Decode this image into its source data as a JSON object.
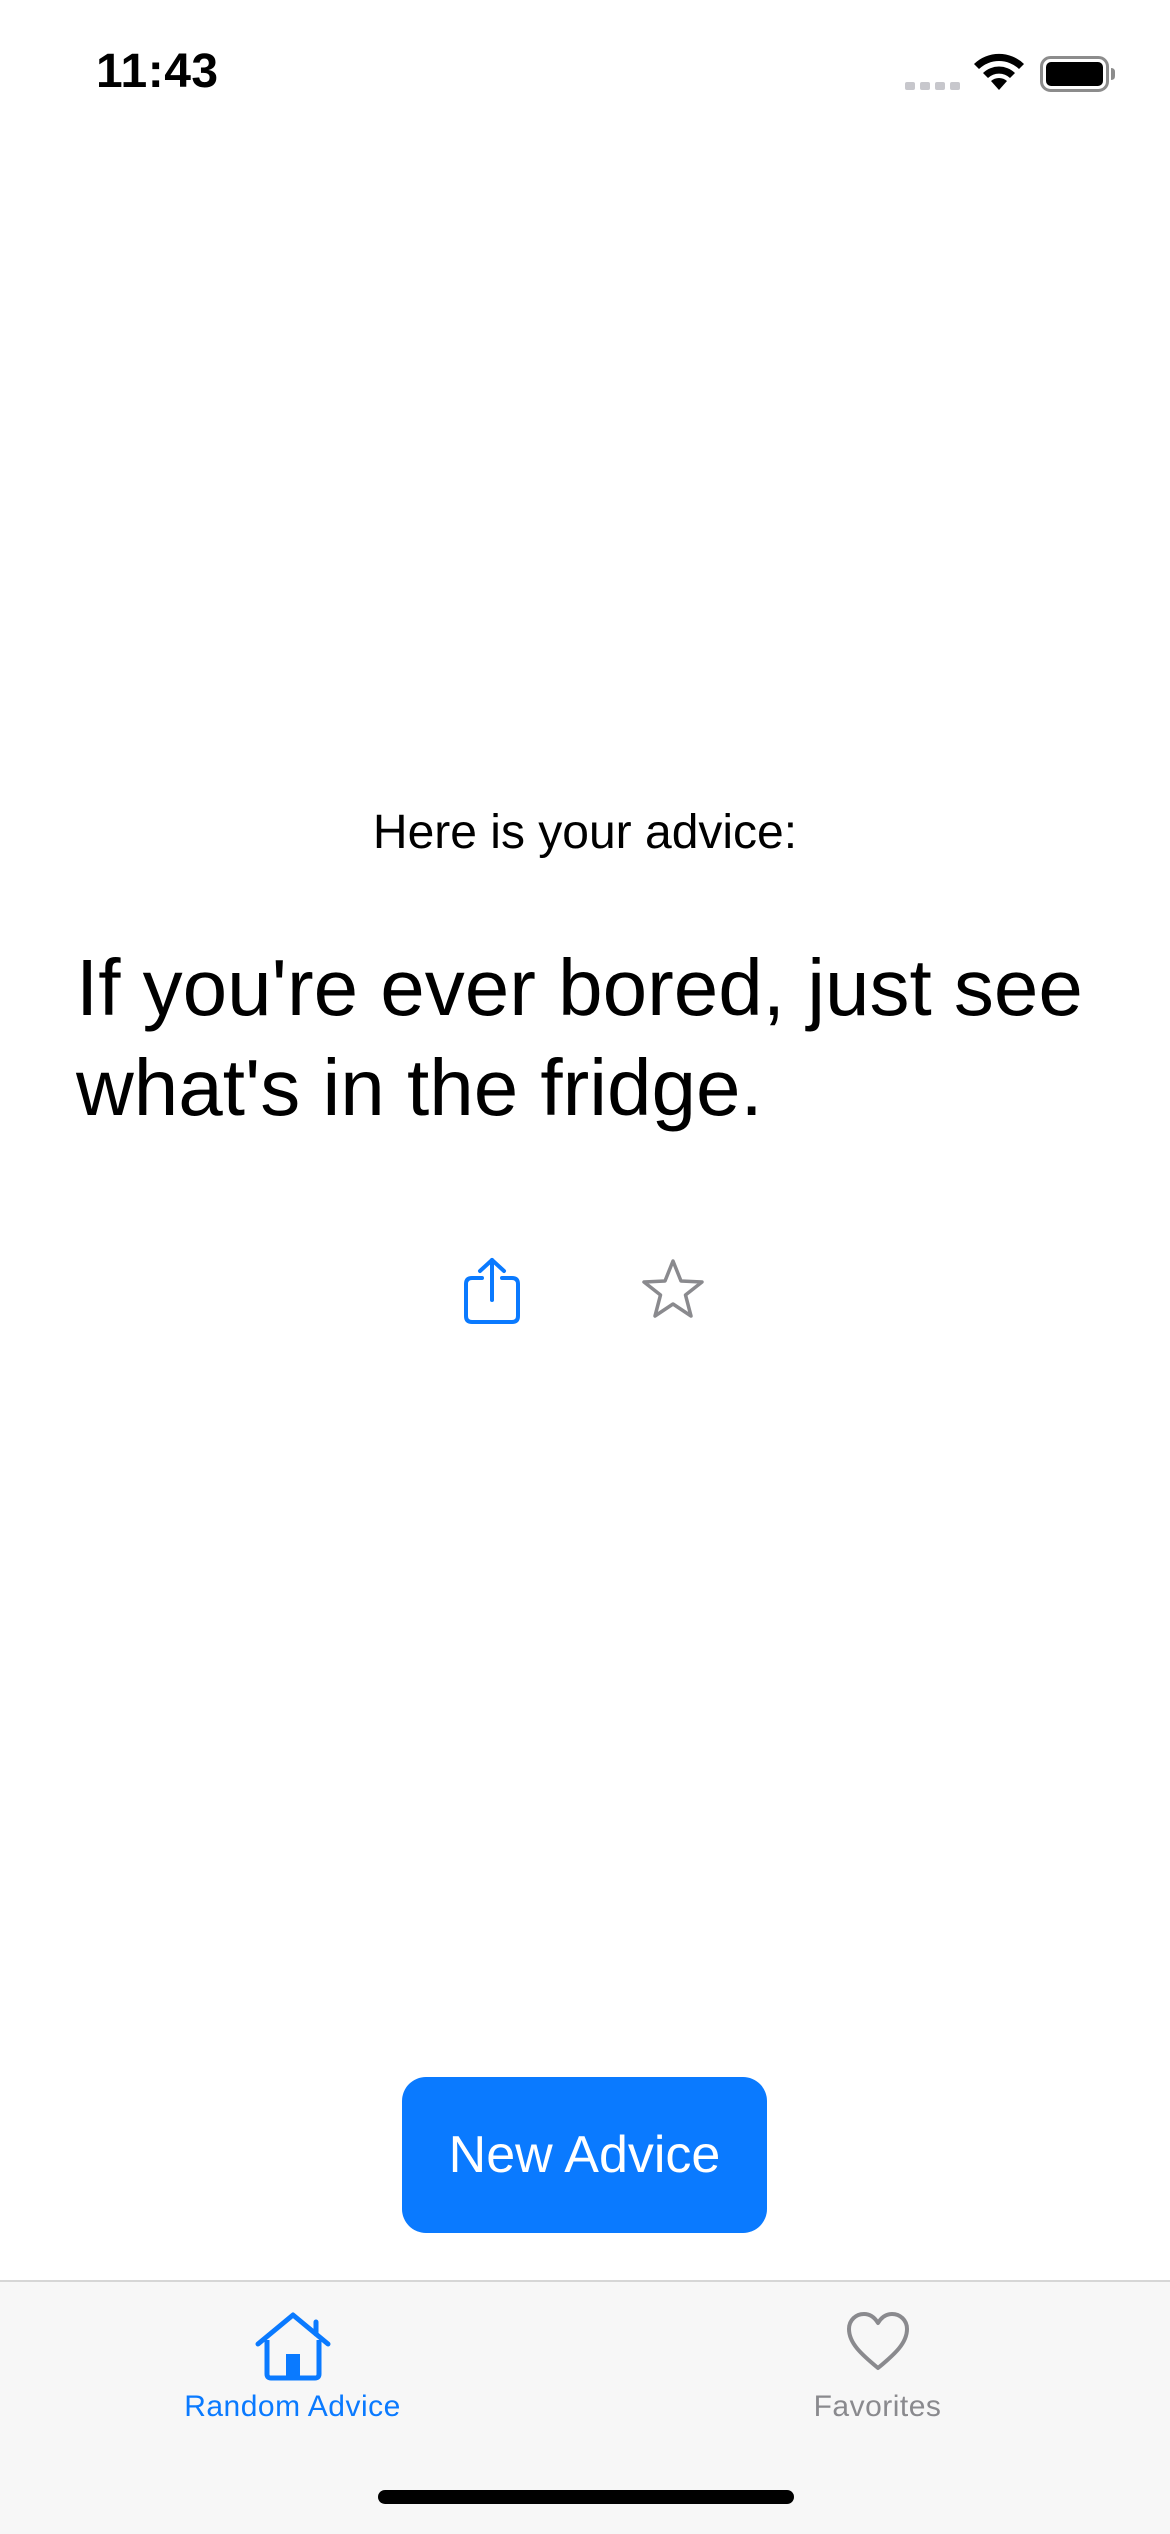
{
  "status_bar": {
    "time": "11:43",
    "icons": [
      "cellular-signal-icon",
      "wifi-icon",
      "battery-icon"
    ]
  },
  "main": {
    "heading": "Here is your advice:",
    "advice": "If you're ever bored, just see what's in the fridge.",
    "actions": [
      {
        "name": "share",
        "icon": "share-icon",
        "color": "#0a7aff"
      },
      {
        "name": "favorite",
        "icon": "star-icon",
        "color": "#8a8a8e"
      }
    ],
    "button_label": "New Advice",
    "button_color": "#0a7aff"
  },
  "tab_bar": {
    "items": [
      {
        "label": "Random Advice",
        "icon": "house-icon",
        "selected": true
      },
      {
        "label": "Favorites",
        "icon": "heart-icon",
        "selected": false
      }
    ],
    "active_color": "#0a7aff",
    "inactive_color": "#8a8a8e"
  }
}
